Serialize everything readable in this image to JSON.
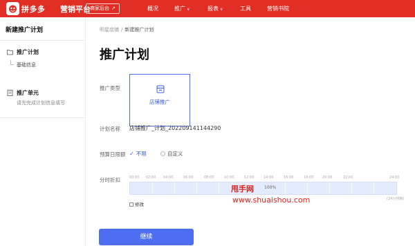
{
  "topbar": {
    "brand": "拼多多",
    "subtitle": "营销平台",
    "backend_button": "商家后台",
    "backend_arrow": "↗",
    "nav": [
      {
        "label": "概况"
      },
      {
        "label": "推广",
        "chevron": "∨"
      },
      {
        "label": "报表",
        "chevron": "∨"
      },
      {
        "label": "工具"
      },
      {
        "label": "营销书院"
      }
    ],
    "accent": "#e02e24"
  },
  "sidebar": {
    "title": "新建推广计划",
    "step1": {
      "label": "推广计划",
      "icon": "folder-icon",
      "sub": "基础信息"
    },
    "step2": {
      "label": "推广单元",
      "icon": "document-icon",
      "desc": "请先完成计划信息填写"
    }
  },
  "breadcrumb": {
    "parent": "明星店铺",
    "sep": "/",
    "current": "新建推广计划"
  },
  "page_title": "推广计划",
  "form": {
    "type_label": "推广类型",
    "type_card": {
      "label": "店铺推广",
      "icon": "store-icon"
    },
    "name_label": "计划名称",
    "name_value": "店铺推广_计划_202209141144290",
    "budget_label": "预算日限额",
    "budget_options": [
      {
        "label": "不限",
        "selected": true
      },
      {
        "label": "自定义",
        "selected": false
      }
    ],
    "discount_label": "分时折扣",
    "ticks": [
      "00:00",
      "02:00",
      "04:00",
      "06:00",
      "08:00",
      "10:00",
      "12:00",
      "14:00",
      "16:00",
      "18:00",
      "20:00",
      "22:00",
      "24:00"
    ],
    "bar_percent": "100%",
    "hours_note": "(24小时制)",
    "edit_label": "修改"
  },
  "watermark": {
    "line1": "甩手网",
    "line2": "www.shuaishou.com"
  },
  "continue_button": "继续",
  "colors": {
    "primary": "#4e6ef2",
    "bar": "#e3ebfc"
  }
}
